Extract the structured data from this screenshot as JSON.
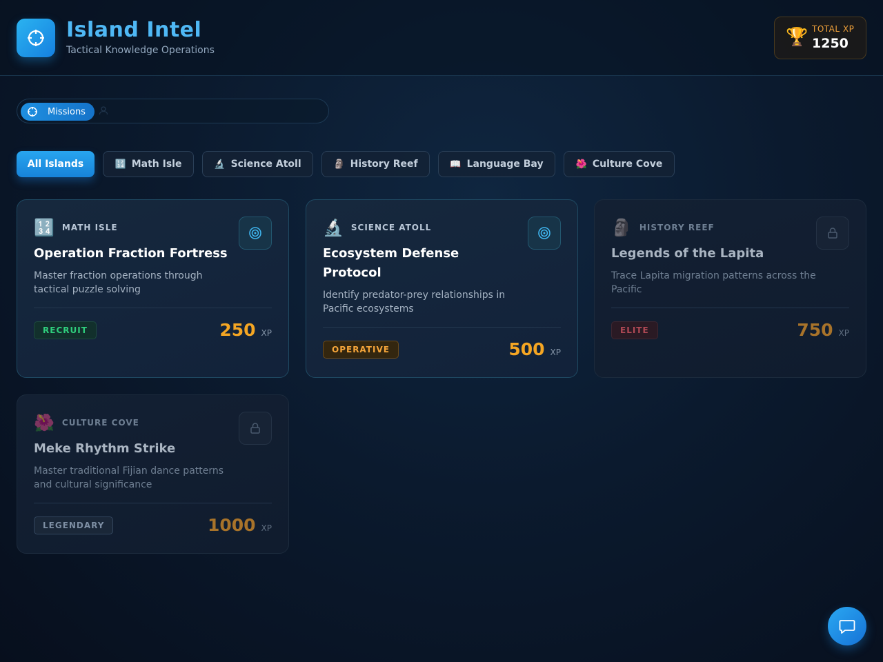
{
  "header": {
    "title": "Island Intel",
    "subtitle": "Tactical Knowledge Operations",
    "logo_icon": "crosshair-icon",
    "xp": {
      "label": "TOTAL XP",
      "value": "1250",
      "icon": "trophy-icon"
    }
  },
  "nav": {
    "tabs": [
      {
        "label": "Missions",
        "icon": "crosshair-icon",
        "active": true
      }
    ]
  },
  "filters": [
    {
      "label": "All Islands",
      "emoji": "",
      "active": true
    },
    {
      "label": "Math Isle",
      "emoji": "🔢",
      "active": false
    },
    {
      "label": "Science Atoll",
      "emoji": "🔬",
      "active": false
    },
    {
      "label": "History Reef",
      "emoji": "🗿",
      "active": false
    },
    {
      "label": "Language Bay",
      "emoji": "📖",
      "active": false
    },
    {
      "label": "Culture Cove",
      "emoji": "🌺",
      "active": false
    }
  ],
  "missions": [
    {
      "category": "MATH ISLE",
      "emoji": "🔢",
      "title": "Operation Fraction Fortress",
      "description": "Master fraction operations through tactical puzzle solving",
      "rank": "RECRUIT",
      "xp": "250",
      "xp_unit": "XP",
      "status": "unlocked",
      "action_icon": "target-icon"
    },
    {
      "category": "SCIENCE ATOLL",
      "emoji": "🔬",
      "title": "Ecosystem Defense Protocol",
      "description": "Identify predator-prey relationships in Pacific ecosystems",
      "rank": "OPERATIVE",
      "xp": "500",
      "xp_unit": "XP",
      "status": "unlocked",
      "action_icon": "target-icon"
    },
    {
      "category": "HISTORY REEF",
      "emoji": "🗿",
      "title": "Legends of the Lapita",
      "description": "Trace Lapita migration patterns across the Pacific",
      "rank": "ELITE",
      "xp": "750",
      "xp_unit": "XP",
      "status": "locked",
      "action_icon": "lock-icon"
    },
    {
      "category": "CULTURE COVE",
      "emoji": "🌺",
      "title": "Meke Rhythm Strike",
      "description": "Master traditional Fijian dance patterns and cultural significance",
      "rank": "LEGENDARY",
      "xp": "1000",
      "xp_unit": "XP",
      "status": "locked",
      "action_icon": "lock-icon"
    }
  ],
  "chat": {
    "icon": "chat-icon"
  },
  "colors": {
    "accent": "#1e8fe0",
    "xp_gold": "#f5a623",
    "recruit": "#2fcf7d",
    "operative": "#f5a53a",
    "elite": "#b04955"
  }
}
